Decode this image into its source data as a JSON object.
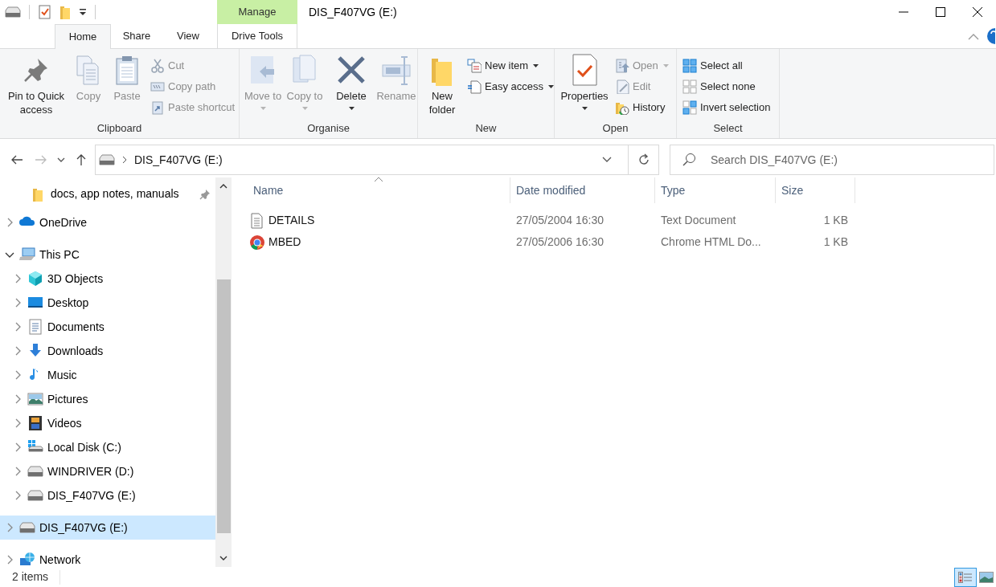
{
  "window": {
    "title": "DIS_F407VG (E:)",
    "context_tab": "Manage"
  },
  "ribbon_tabs": [
    {
      "label": "Home",
      "selected": true
    },
    {
      "label": "Share",
      "selected": false
    },
    {
      "label": "View",
      "selected": false
    },
    {
      "label": "Drive Tools",
      "selected": false
    }
  ],
  "ribbon_groups": [
    {
      "label": "Clipboard",
      "large": [
        {
          "label": "Pin to Quick access",
          "disabled": false,
          "dropdown": false
        },
        {
          "label": "Copy",
          "disabled": true,
          "dropdown": false
        },
        {
          "label": "Paste",
          "disabled": true,
          "dropdown": false
        }
      ],
      "small": [
        {
          "label": "Cut",
          "disabled": true,
          "dropdown": false
        },
        {
          "label": "Copy path",
          "disabled": true,
          "dropdown": false
        },
        {
          "label": "Paste shortcut",
          "disabled": true,
          "dropdown": false
        }
      ]
    },
    {
      "label": "Organise",
      "large": [
        {
          "label": "Move to",
          "disabled": true,
          "dropdown": true
        },
        {
          "label": "Copy to",
          "disabled": true,
          "dropdown": true
        },
        {
          "label": "Delete",
          "disabled": false,
          "dropdown": true
        },
        {
          "label": "Rename",
          "disabled": true,
          "dropdown": false
        }
      ]
    },
    {
      "label": "New",
      "large": [
        {
          "label": "New folder",
          "disabled": false,
          "dropdown": false
        }
      ],
      "small": [
        {
          "label": "New item",
          "disabled": false,
          "dropdown": true
        },
        {
          "label": "Easy access",
          "disabled": false,
          "dropdown": true
        }
      ]
    },
    {
      "label": "Open",
      "large": [
        {
          "label": "Properties",
          "disabled": false,
          "dropdown": true
        }
      ],
      "small": [
        {
          "label": "Open",
          "disabled": true,
          "dropdown": true
        },
        {
          "label": "Edit",
          "disabled": true,
          "dropdown": false
        },
        {
          "label": "History",
          "disabled": false,
          "dropdown": false
        }
      ]
    },
    {
      "label": "Select",
      "small": [
        {
          "label": "Select all",
          "disabled": false,
          "dropdown": false
        },
        {
          "label": "Select none",
          "disabled": false,
          "dropdown": false
        },
        {
          "label": "Invert selection",
          "disabled": false,
          "dropdown": false
        }
      ]
    }
  ],
  "address": {
    "path": "DIS_F407VG (E:)"
  },
  "search": {
    "placeholder": "Search DIS_F407VG (E:)"
  },
  "quick_access_items": [
    {
      "label": "docs, app notes, manuals",
      "kind": "folder",
      "pinned": true
    }
  ],
  "nav_tree": [
    {
      "label": "OneDrive",
      "kind": "onedrive",
      "expanded": false,
      "selected": false
    },
    {
      "label": "This PC",
      "kind": "pc",
      "expanded": true,
      "selected": false,
      "children": [
        {
          "label": "3D Objects",
          "kind": "objects3d",
          "expanded": false,
          "selected": false
        },
        {
          "label": "Desktop",
          "kind": "desktop",
          "expanded": false,
          "selected": false
        },
        {
          "label": "Documents",
          "kind": "documents",
          "expanded": false,
          "selected": false
        },
        {
          "label": "Downloads",
          "kind": "downloads",
          "expanded": false,
          "selected": false
        },
        {
          "label": "Music",
          "kind": "music",
          "expanded": false,
          "selected": false
        },
        {
          "label": "Pictures",
          "kind": "pictures",
          "expanded": false,
          "selected": false
        },
        {
          "label": "Videos",
          "kind": "videos",
          "expanded": false,
          "selected": false
        },
        {
          "label": "Local Disk (C:)",
          "kind": "systemdrive",
          "expanded": false,
          "selected": false
        },
        {
          "label": "WINDRIVER (D:)",
          "kind": "drive",
          "expanded": false,
          "selected": false
        },
        {
          "label": "DIS_F407VG (E:)",
          "kind": "drive",
          "expanded": false,
          "selected": false
        }
      ]
    },
    {
      "label": "DIS_F407VG (E:)",
      "kind": "drive",
      "expanded": false,
      "selected": true
    },
    {
      "label": "Network",
      "kind": "network",
      "expanded": false,
      "selected": false
    }
  ],
  "file_list": {
    "columns": [
      "Name",
      "Date modified",
      "Type",
      "Size"
    ],
    "rows": [
      {
        "name": "DETAILS",
        "kind": "text",
        "date_modified": "27/05/2004 16:30",
        "type": "Text Document",
        "size": "1 KB"
      },
      {
        "name": "MBED",
        "kind": "chrome",
        "date_modified": "27/05/2006 16:30",
        "type": "Chrome HTML Do...",
        "size": "1 KB"
      }
    ]
  },
  "status_bar": {
    "item_count": "2 items",
    "views": [
      {
        "kind": "details",
        "selected": true
      },
      {
        "kind": "thumbnails",
        "selected": false
      }
    ]
  }
}
